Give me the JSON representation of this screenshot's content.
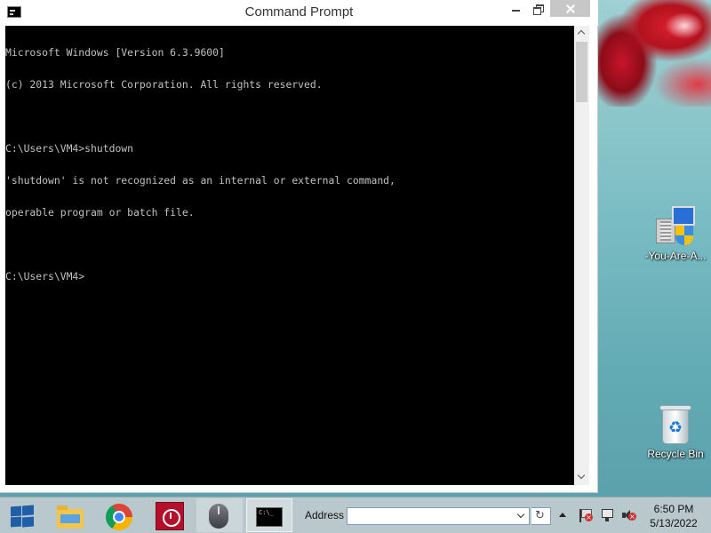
{
  "window": {
    "title": "Command Prompt",
    "console_lines": [
      "Microsoft Windows [Version 6.3.9600]",
      "(c) 2013 Microsoft Corporation. All rights reserved.",
      "",
      "C:\\Users\\VM4>shutdown",
      "'shutdown' is not recognized as an internal or external command,",
      "operable program or batch file.",
      "",
      "C:\\Users\\VM4>"
    ]
  },
  "desktop": {
    "icons": [
      {
        "name": "installer-shortcut",
        "label": "-You-Are-A...",
        "icon": "installer-icon"
      },
      {
        "name": "recycle-bin",
        "label": "Recycle Bin",
        "icon": "recycle-bin-icon"
      }
    ]
  },
  "taskbar": {
    "pinned": [
      "start-icon",
      "file-explorer-icon",
      "chrome-icon",
      "alarm-clock-icon",
      "mouse-icon",
      "command-prompt-icon"
    ],
    "address_label": "Address",
    "address_value": "",
    "clock": {
      "time": "6:50 PM",
      "date": "5/13/2022"
    }
  },
  "colors": {
    "console_bg": "#000000",
    "console_text": "#c0c0c0",
    "taskbar_bg": "#b8c8cc",
    "close_button": "#c7c7c7"
  }
}
